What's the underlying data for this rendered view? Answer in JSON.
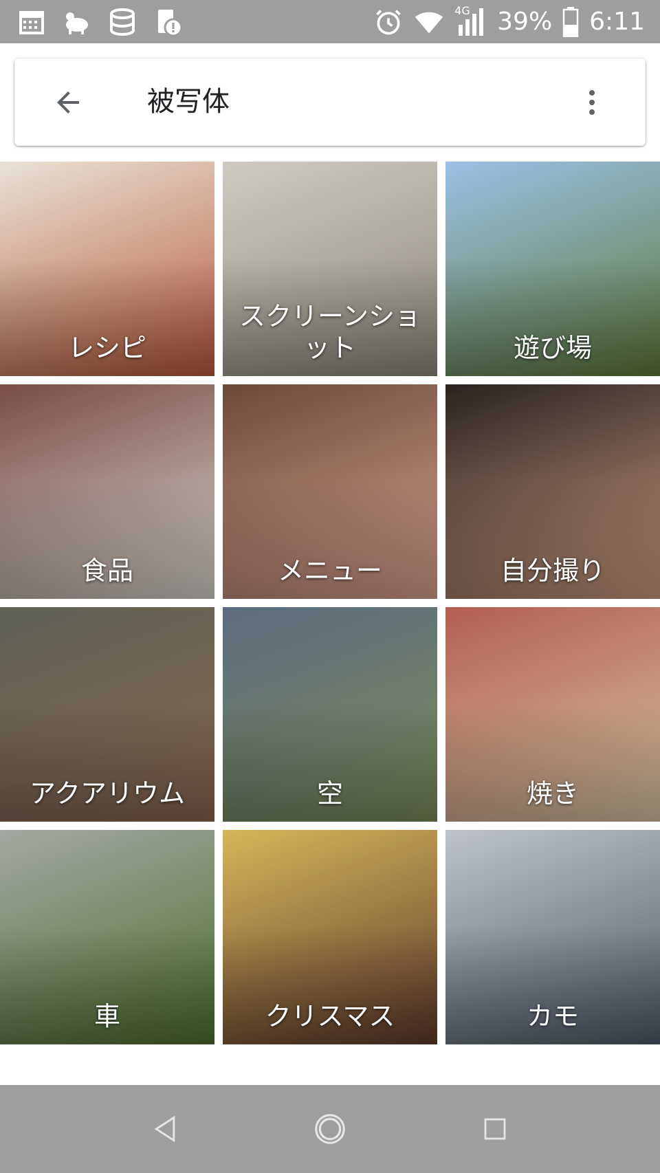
{
  "status_bar": {
    "icons_left": [
      "calendar-icon",
      "pet-icon",
      "storage-icon",
      "clipboard-alert-icon"
    ],
    "icons_right": [
      "alarm-icon",
      "wifi-icon",
      "signal-4g-icon",
      "battery-icon"
    ],
    "network": "4G",
    "battery": "39%",
    "time": "6:11"
  },
  "app_bar": {
    "back_icon": "arrow-back-icon",
    "title": "被写体",
    "more_icon": "more-vert-icon"
  },
  "categories": [
    {
      "label": "レシピ",
      "colors": [
        "#e9e2d6",
        "#b85a3a"
      ]
    },
    {
      "label": "スクリーンショット",
      "colors": [
        "#cfcbc4",
        "#8d877d"
      ]
    },
    {
      "label": "遊び場",
      "colors": [
        "#9cc0e6",
        "#5d7a3a"
      ]
    },
    {
      "label": "食品",
      "colors": [
        "#7a4d45",
        "#d6d3cc"
      ]
    },
    {
      "label": "メニュー",
      "colors": [
        "#6b4a3a",
        "#d7a08d"
      ]
    },
    {
      "label": "自分撮り",
      "colors": [
        "#2a2220",
        "#c99a7e"
      ]
    },
    {
      "label": "アクアリウム",
      "colors": [
        "#5e6254",
        "#8a6650"
      ]
    },
    {
      "label": "空",
      "colors": [
        "#5d6c80",
        "#7b8c5a"
      ]
    },
    {
      "label": "焼き",
      "colors": [
        "#b45f50",
        "#d6c3a2"
      ]
    },
    {
      "label": "車",
      "colors": [
        "#a4a8a2",
        "#4d6f2e"
      ]
    },
    {
      "label": "クリスマス",
      "colors": [
        "#d6b65a",
        "#5f3a2c"
      ]
    },
    {
      "label": "カモ",
      "colors": [
        "#bfc4ca",
        "#505a6a"
      ]
    }
  ],
  "nav_bar": {
    "back": "nav-back-icon",
    "home": "nav-home-icon",
    "recents": "nav-recents-icon"
  }
}
